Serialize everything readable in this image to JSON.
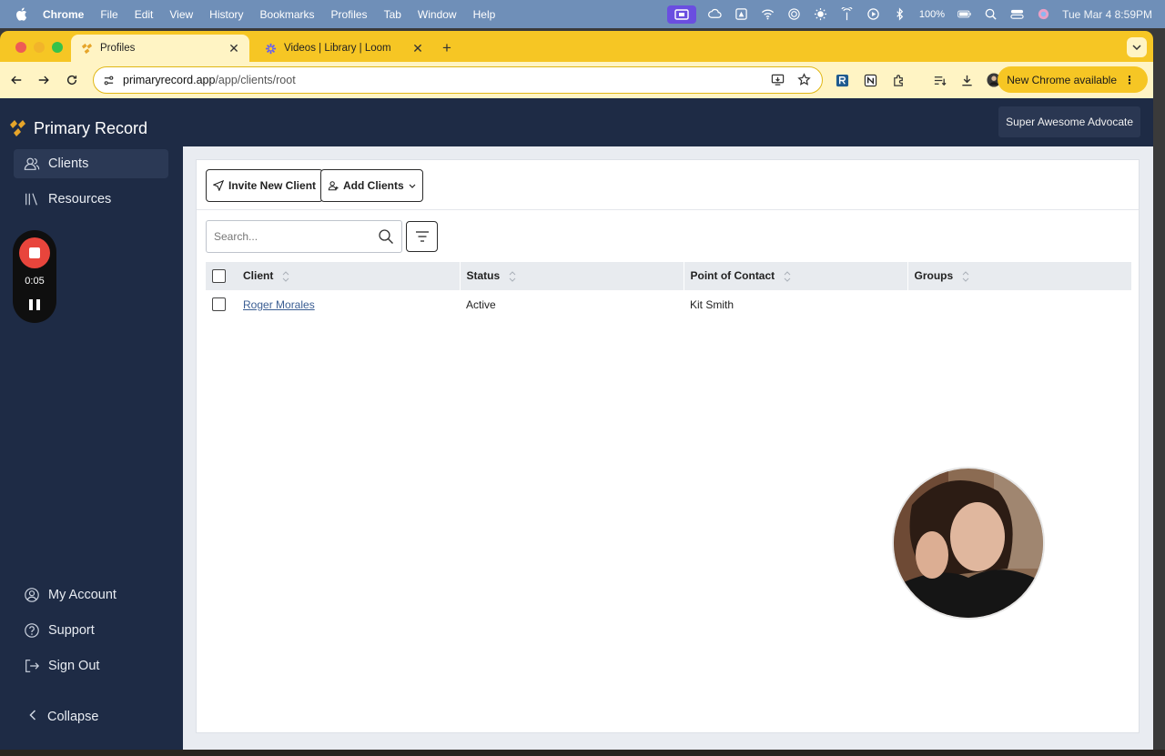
{
  "menubar": {
    "app_name": "Chrome",
    "items": [
      "File",
      "Edit",
      "View",
      "History",
      "Bookmarks",
      "Profiles",
      "Tab",
      "Window",
      "Help"
    ],
    "battery": "100%",
    "clock": "Tue Mar 4  8:59PM"
  },
  "browser": {
    "tabs": [
      {
        "title": "Profiles",
        "favicon": "primary-record-logo"
      },
      {
        "title": "Videos | Library | Loom",
        "favicon": "loom-logo"
      }
    ],
    "url_host": "primaryrecord.app",
    "url_path": "/app/clients/root",
    "update_label": "New Chrome available"
  },
  "app": {
    "brand": "Primary Record",
    "user_button": "Super Awesome Advocate",
    "nav": {
      "clients": "Clients",
      "resources": "Resources",
      "my_account": "My Account",
      "support": "Support",
      "sign_out": "Sign Out",
      "collapse": "Collapse"
    },
    "recorder": {
      "time": "0:05"
    },
    "actions": {
      "invite": "Invite New Client",
      "add": "Add Clients"
    },
    "search": {
      "placeholder": "Search..."
    },
    "table": {
      "columns": [
        "Client",
        "Status",
        "Point of Contact",
        "Groups"
      ],
      "rows": [
        {
          "client": "Roger Morales",
          "status": "Active",
          "contact": "Kit Smith",
          "groups": ""
        }
      ]
    }
  },
  "colors": {
    "chrome_frame": "#f6c624",
    "sidebar": "#1e2b45",
    "record_red": "#e8453c",
    "link": "#3b5e93"
  }
}
